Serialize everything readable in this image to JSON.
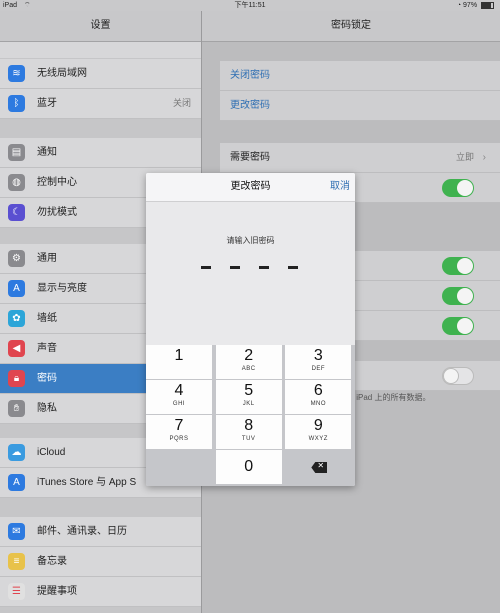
{
  "status": {
    "device": "iPad",
    "time": "下午11:51",
    "battery": "97%"
  },
  "left": {
    "title": "设置",
    "group1": [
      {
        "label": "无线局域网",
        "icon": "wifi-icon",
        "color": "#2d7ae0"
      },
      {
        "label": "蓝牙",
        "value": "关闭",
        "icon": "bluetooth-icon",
        "color": "#2d7ae0"
      }
    ],
    "group2": [
      {
        "label": "通知",
        "icon": "notifications-icon",
        "color": "#8a8a8e"
      },
      {
        "label": "控制中心",
        "icon": "control-center-icon",
        "color": "#8a8a8e"
      },
      {
        "label": "勿扰模式",
        "icon": "moon-icon",
        "color": "#5a4fd1"
      }
    ],
    "group3": [
      {
        "label": "通用",
        "icon": "gear-icon",
        "color": "#8a8a8e"
      },
      {
        "label": "显示与亮度",
        "icon": "brightness-icon",
        "color": "#2d7ae0"
      },
      {
        "label": "墙纸",
        "icon": "wallpaper-icon",
        "color": "#2ca5d8"
      },
      {
        "label": "声音",
        "icon": "sound-icon",
        "color": "#e0454f"
      },
      {
        "label": "密码",
        "icon": "lock-icon",
        "color": "#e0454f",
        "selected": true
      },
      {
        "label": "隐私",
        "icon": "hand-icon",
        "color": "#8a8a8e"
      }
    ],
    "group4": [
      {
        "label": "iCloud",
        "icon": "cloud-icon",
        "color": "#3a9be0"
      },
      {
        "label": "iTunes Store 与 App S",
        "icon": "appstore-icon",
        "color": "#2d7ae0"
      }
    ],
    "group5": [
      {
        "label": "邮件、通讯录、日历",
        "icon": "mail-icon",
        "color": "#2d7ae0"
      },
      {
        "label": "备忘录",
        "icon": "notes-icon",
        "color": "#e8c24a"
      },
      {
        "label": "提醒事项",
        "icon": "reminders-icon",
        "color": "#e0e0e0"
      }
    ]
  },
  "right": {
    "title": "密码锁定",
    "links": [
      "关闭密码",
      "更改密码"
    ],
    "require_label": "需要密码",
    "require_value": "立即",
    "footer_note": "除此 iPad 上的所有数据。"
  },
  "modal": {
    "title": "更改密码",
    "cancel": "取消",
    "prompt": "请输入旧密码",
    "digits_entered": 0,
    "keys": [
      {
        "d": "1",
        "s": ""
      },
      {
        "d": "2",
        "s": "ABC"
      },
      {
        "d": "3",
        "s": "DEF"
      },
      {
        "d": "4",
        "s": "GHI"
      },
      {
        "d": "5",
        "s": "JKL"
      },
      {
        "d": "6",
        "s": "MNO"
      },
      {
        "d": "7",
        "s": "PQRS"
      },
      {
        "d": "8",
        "s": "TUV"
      },
      {
        "d": "9",
        "s": "WXYZ"
      },
      {
        "d": "0",
        "s": ""
      }
    ]
  }
}
